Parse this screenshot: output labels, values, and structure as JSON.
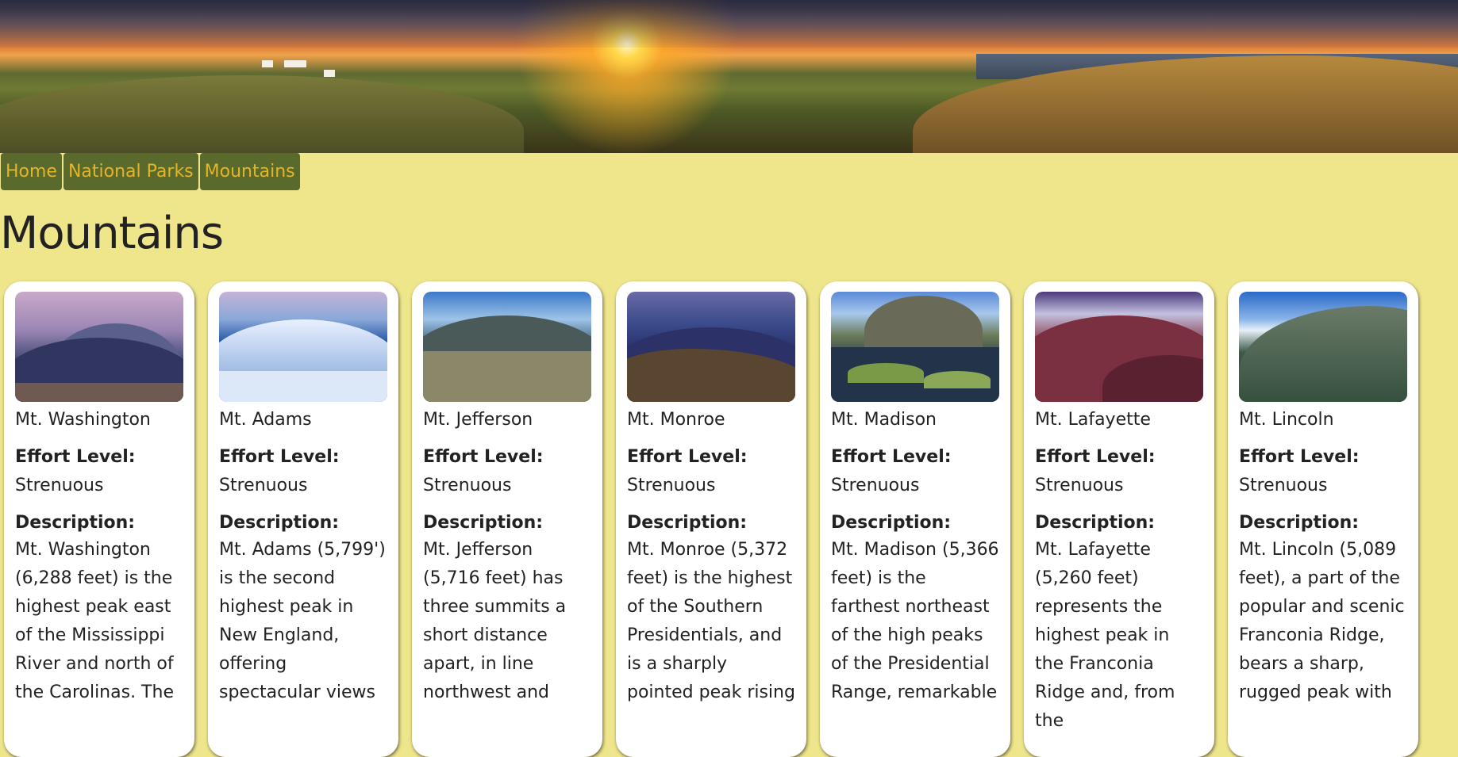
{
  "banner": {
    "alt": "sunset landscape"
  },
  "nav": [
    "Home",
    "National Parks",
    "Mountains"
  ],
  "title": "Mountains",
  "effort_label": "Effort Level:",
  "desc_label": "Description:",
  "cards": [
    {
      "name": "Mt. Washington",
      "effort": "Strenuous",
      "description": "Mt. Washington (6,288 feet) is the highest peak east of the Mississippi River and north of the Carolinas. The"
    },
    {
      "name": "Mt. Adams",
      "effort": "Strenuous",
      "description": "Mt. Adams (5,799') is the second highest peak in New England, offering spectacular views"
    },
    {
      "name": "Mt. Jefferson",
      "effort": "Strenuous",
      "description": "Mt. Jefferson (5,716 feet) has three summits a short distance apart, in line northwest and"
    },
    {
      "name": "Mt. Monroe",
      "effort": "Strenuous",
      "description": "Mt. Monroe (5,372 feet) is the highest of the Southern Presidentials, and is a sharply pointed peak rising"
    },
    {
      "name": "Mt. Madison",
      "effort": "Strenuous",
      "description": "Mt. Madison (5,366 feet) is the farthest northeast of the high peaks of the Presidential Range, remarkable"
    },
    {
      "name": "Mt. Lafayette",
      "effort": "Strenuous",
      "description": "Mt. Lafayette (5,260 feet) represents the highest peak in the Franconia Ridge and, from the"
    },
    {
      "name": "Mt. Lincoln",
      "effort": "Strenuous",
      "description": "Mt. Lincoln (5,089 feet), a part of the popular and scenic Franconia Ridge, bears a sharp, rugged peak with"
    }
  ]
}
